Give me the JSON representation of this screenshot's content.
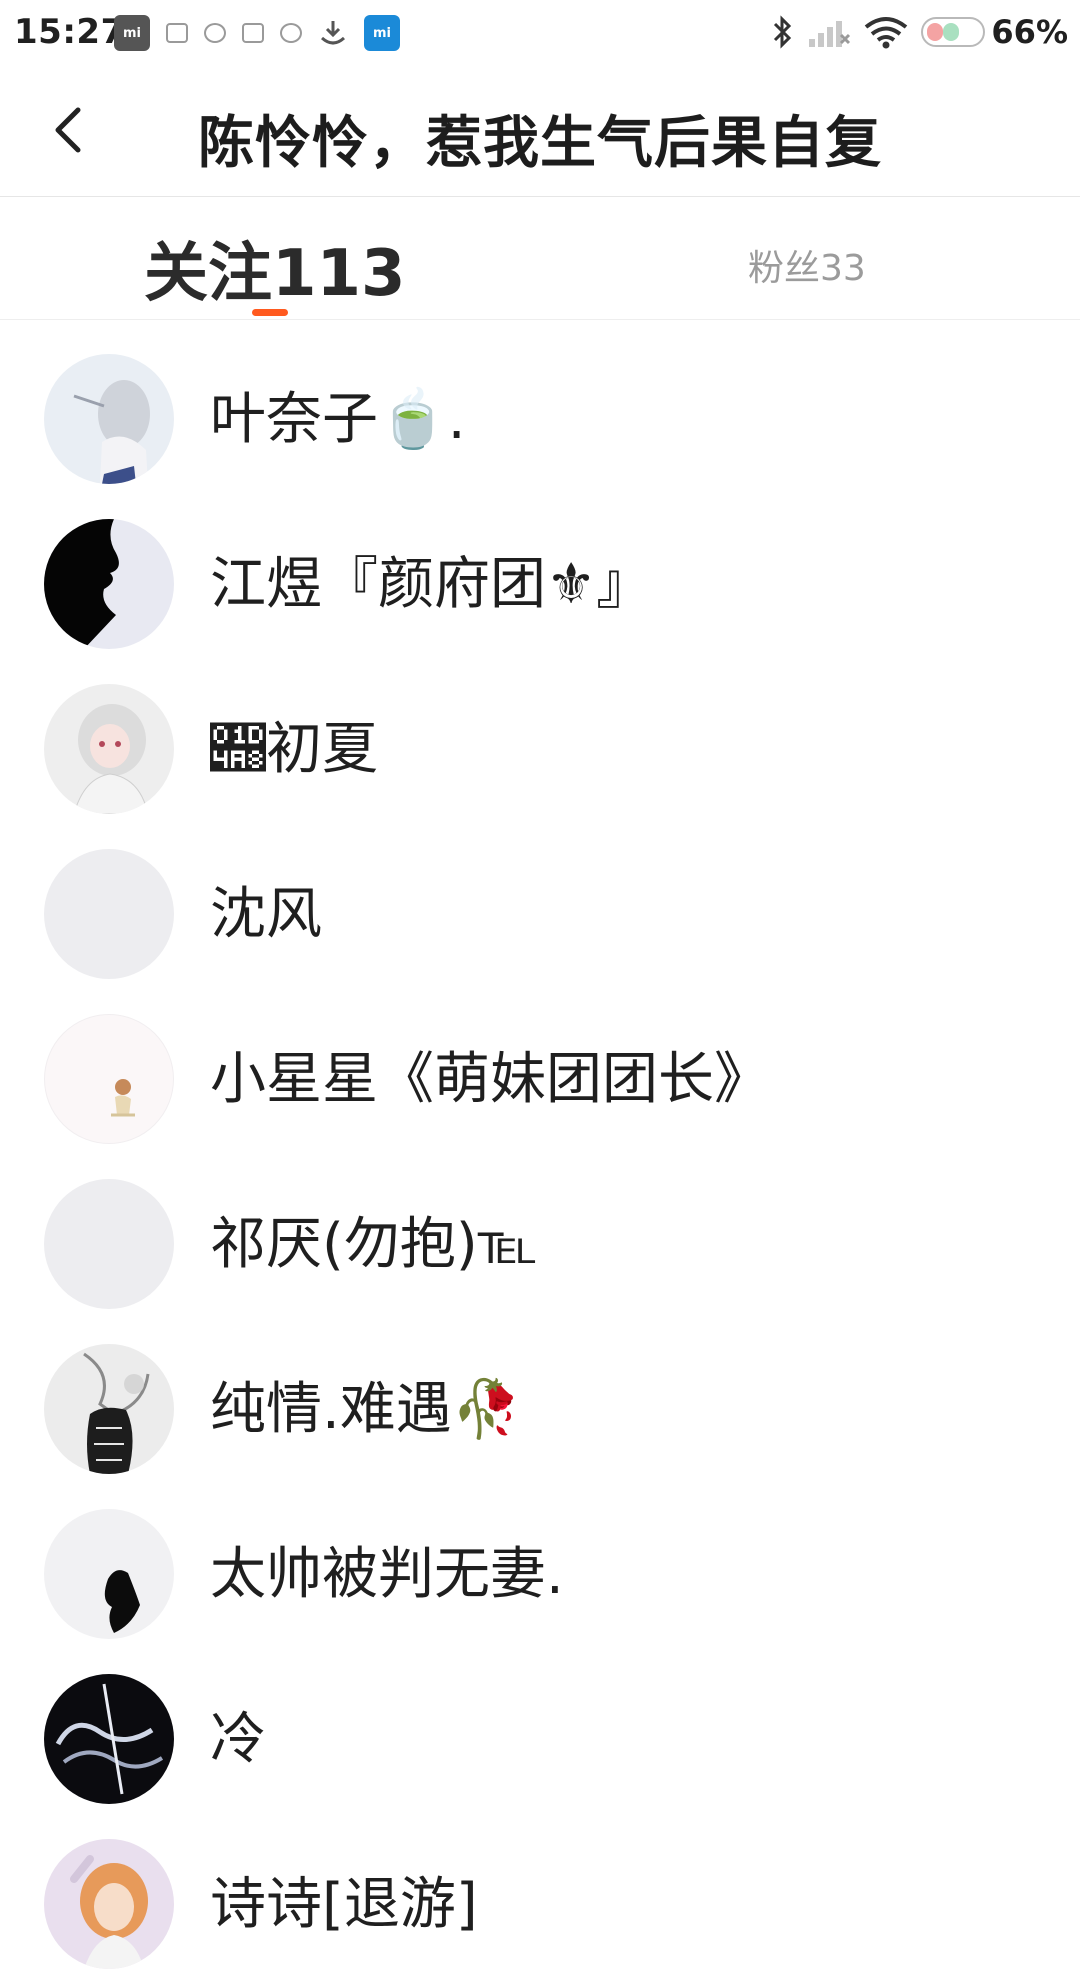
{
  "status_bar": {
    "time": "15:27",
    "notification_icons": [
      "mi-icon",
      "image-icon",
      "cloud-icon",
      "gallery-icon",
      "message-icon",
      "download-icon",
      "mi-app-icon"
    ],
    "system_icons": [
      "bluetooth-icon",
      "cellular-signal-icon",
      "wifi-icon",
      "battery-icon"
    ],
    "battery_percent": "66%",
    "mi_label": "mi"
  },
  "header": {
    "title": "陈怜怜，惹我生气后果自复",
    "back_icon": "chevron-left-icon"
  },
  "tabs": {
    "following_label": "关注113",
    "fans_label": "粉丝33",
    "active": "following",
    "accent_color": "#ff5a1f"
  },
  "users": [
    {
      "name": "叶奈子🍵."
    },
    {
      "name": "江煜『颜府团⚜』"
    },
    {
      "name": "𝒨初夏"
    },
    {
      "name": "沈风"
    },
    {
      "name": "小星星《萌妹团团长》"
    },
    {
      "name": "祁厌(勿抱)℡"
    },
    {
      "name": "纯情.难遇🥀"
    },
    {
      "name": "太帅被判无妻."
    },
    {
      "name": "冷"
    },
    {
      "name": "诗诗[退游]"
    }
  ]
}
